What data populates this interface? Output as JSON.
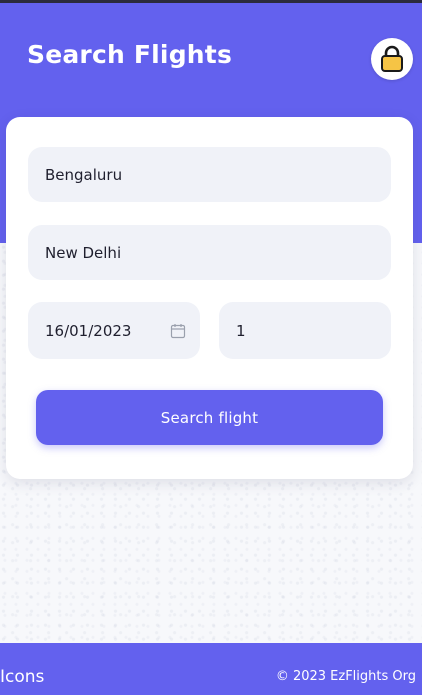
{
  "header": {
    "title": "Search Flights",
    "lock_icon": "lock-icon",
    "background_color": "#6361ee"
  },
  "form": {
    "from_value": "Bengaluru",
    "to_value": "New Delhi",
    "date_value": "16/01/2023",
    "date_icon": "calendar-icon",
    "passengers_value": "1",
    "submit_label": "Search flight",
    "accent_color": "#6361ee"
  },
  "footer": {
    "left_text": "Icons",
    "copyright": "© 2023 EzFlights Org"
  }
}
